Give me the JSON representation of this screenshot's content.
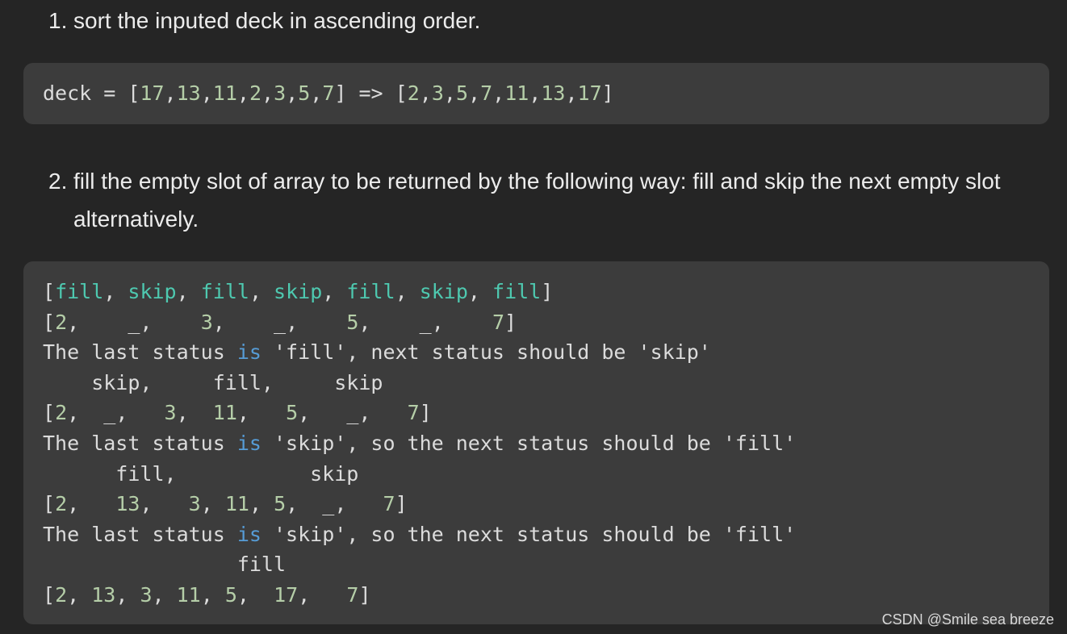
{
  "steps": [
    {
      "number": "1.",
      "text": "sort the inputed deck in ascending order."
    },
    {
      "number": "2.",
      "text": "fill the empty slot of array to be returned by the following way: fill and skip the next empty slot alternatively."
    }
  ],
  "code1": {
    "lines": [
      [
        {
          "t": "deck = [",
          "c": "s"
        },
        {
          "t": "17",
          "c": "n"
        },
        {
          "t": ",",
          "c": "s"
        },
        {
          "t": "13",
          "c": "n"
        },
        {
          "t": ",",
          "c": "s"
        },
        {
          "t": "11",
          "c": "n"
        },
        {
          "t": ",",
          "c": "s"
        },
        {
          "t": "2",
          "c": "n"
        },
        {
          "t": ",",
          "c": "s"
        },
        {
          "t": "3",
          "c": "n"
        },
        {
          "t": ",",
          "c": "s"
        },
        {
          "t": "5",
          "c": "n"
        },
        {
          "t": ",",
          "c": "s"
        },
        {
          "t": "7",
          "c": "n"
        },
        {
          "t": "] => [",
          "c": "s"
        },
        {
          "t": "2",
          "c": "n"
        },
        {
          "t": ",",
          "c": "s"
        },
        {
          "t": "3",
          "c": "n"
        },
        {
          "t": ",",
          "c": "s"
        },
        {
          "t": "5",
          "c": "n"
        },
        {
          "t": ",",
          "c": "s"
        },
        {
          "t": "7",
          "c": "n"
        },
        {
          "t": ",",
          "c": "s"
        },
        {
          "t": "11",
          "c": "n"
        },
        {
          "t": ",",
          "c": "s"
        },
        {
          "t": "13",
          "c": "n"
        },
        {
          "t": ",",
          "c": "s"
        },
        {
          "t": "17",
          "c": "n"
        },
        {
          "t": "]",
          "c": "s"
        }
      ]
    ]
  },
  "code2": {
    "lines": [
      [
        {
          "t": "[",
          "c": "s"
        },
        {
          "t": "fill",
          "c": "k"
        },
        {
          "t": ", ",
          "c": "s"
        },
        {
          "t": "skip",
          "c": "k"
        },
        {
          "t": ", ",
          "c": "s"
        },
        {
          "t": "fill",
          "c": "k"
        },
        {
          "t": ", ",
          "c": "s"
        },
        {
          "t": "skip",
          "c": "k"
        },
        {
          "t": ", ",
          "c": "s"
        },
        {
          "t": "fill",
          "c": "k"
        },
        {
          "t": ", ",
          "c": "s"
        },
        {
          "t": "skip",
          "c": "k"
        },
        {
          "t": ", ",
          "c": "s"
        },
        {
          "t": "fill",
          "c": "k"
        },
        {
          "t": "]",
          "c": "s"
        }
      ],
      [
        {
          "t": "[",
          "c": "s"
        },
        {
          "t": "2",
          "c": "n"
        },
        {
          "t": ",    _,    ",
          "c": "s"
        },
        {
          "t": "3",
          "c": "n"
        },
        {
          "t": ",    _,    ",
          "c": "s"
        },
        {
          "t": "5",
          "c": "n"
        },
        {
          "t": ",    _,    ",
          "c": "s"
        },
        {
          "t": "7",
          "c": "n"
        },
        {
          "t": "]",
          "c": "s"
        }
      ],
      [
        {
          "t": "The last status ",
          "c": "s"
        },
        {
          "t": "is",
          "c": "kw"
        },
        {
          "t": " 'fill', next status should be 'skip'",
          "c": "s"
        }
      ],
      [
        {
          "t": "    skip,     fill,     skip",
          "c": "s"
        }
      ],
      [
        {
          "t": "[",
          "c": "s"
        },
        {
          "t": "2",
          "c": "n"
        },
        {
          "t": ",  _,   ",
          "c": "s"
        },
        {
          "t": "3",
          "c": "n"
        },
        {
          "t": ",  ",
          "c": "s"
        },
        {
          "t": "11",
          "c": "n"
        },
        {
          "t": ",   ",
          "c": "s"
        },
        {
          "t": "5",
          "c": "n"
        },
        {
          "t": ",   _,   ",
          "c": "s"
        },
        {
          "t": "7",
          "c": "n"
        },
        {
          "t": "]",
          "c": "s"
        }
      ],
      [
        {
          "t": "The last status ",
          "c": "s"
        },
        {
          "t": "is",
          "c": "kw"
        },
        {
          "t": " 'skip', so the next status should be 'fill'",
          "c": "s"
        }
      ],
      [
        {
          "t": "      fill,           skip",
          "c": "s"
        }
      ],
      [
        {
          "t": "[",
          "c": "s"
        },
        {
          "t": "2",
          "c": "n"
        },
        {
          "t": ",   ",
          "c": "s"
        },
        {
          "t": "13",
          "c": "n"
        },
        {
          "t": ",   ",
          "c": "s"
        },
        {
          "t": "3",
          "c": "n"
        },
        {
          "t": ", ",
          "c": "s"
        },
        {
          "t": "11",
          "c": "n"
        },
        {
          "t": ", ",
          "c": "s"
        },
        {
          "t": "5",
          "c": "n"
        },
        {
          "t": ",  _,   ",
          "c": "s"
        },
        {
          "t": "7",
          "c": "n"
        },
        {
          "t": "]",
          "c": "s"
        }
      ],
      [
        {
          "t": "The last status ",
          "c": "s"
        },
        {
          "t": "is",
          "c": "kw"
        },
        {
          "t": " 'skip', so the next status should be 'fill'",
          "c": "s"
        }
      ],
      [
        {
          "t": "                fill",
          "c": "s"
        }
      ],
      [
        {
          "t": "[",
          "c": "s"
        },
        {
          "t": "2",
          "c": "n"
        },
        {
          "t": ", ",
          "c": "s"
        },
        {
          "t": "13",
          "c": "n"
        },
        {
          "t": ", ",
          "c": "s"
        },
        {
          "t": "3",
          "c": "n"
        },
        {
          "t": ", ",
          "c": "s"
        },
        {
          "t": "11",
          "c": "n"
        },
        {
          "t": ", ",
          "c": "s"
        },
        {
          "t": "5",
          "c": "n"
        },
        {
          "t": ",  ",
          "c": "s"
        },
        {
          "t": "17",
          "c": "n"
        },
        {
          "t": ",   ",
          "c": "s"
        },
        {
          "t": "7",
          "c": "n"
        },
        {
          "t": "]",
          "c": "s"
        }
      ]
    ]
  },
  "colors": {
    "background": "#252525",
    "code_background": "#3c3c3c",
    "number": "#b5cea8",
    "keyword_teal": "#4ec9b0",
    "keyword_blue": "#569cd6",
    "text": "#dcdcdc"
  },
  "watermark": "CSDN @Smile sea breeze"
}
